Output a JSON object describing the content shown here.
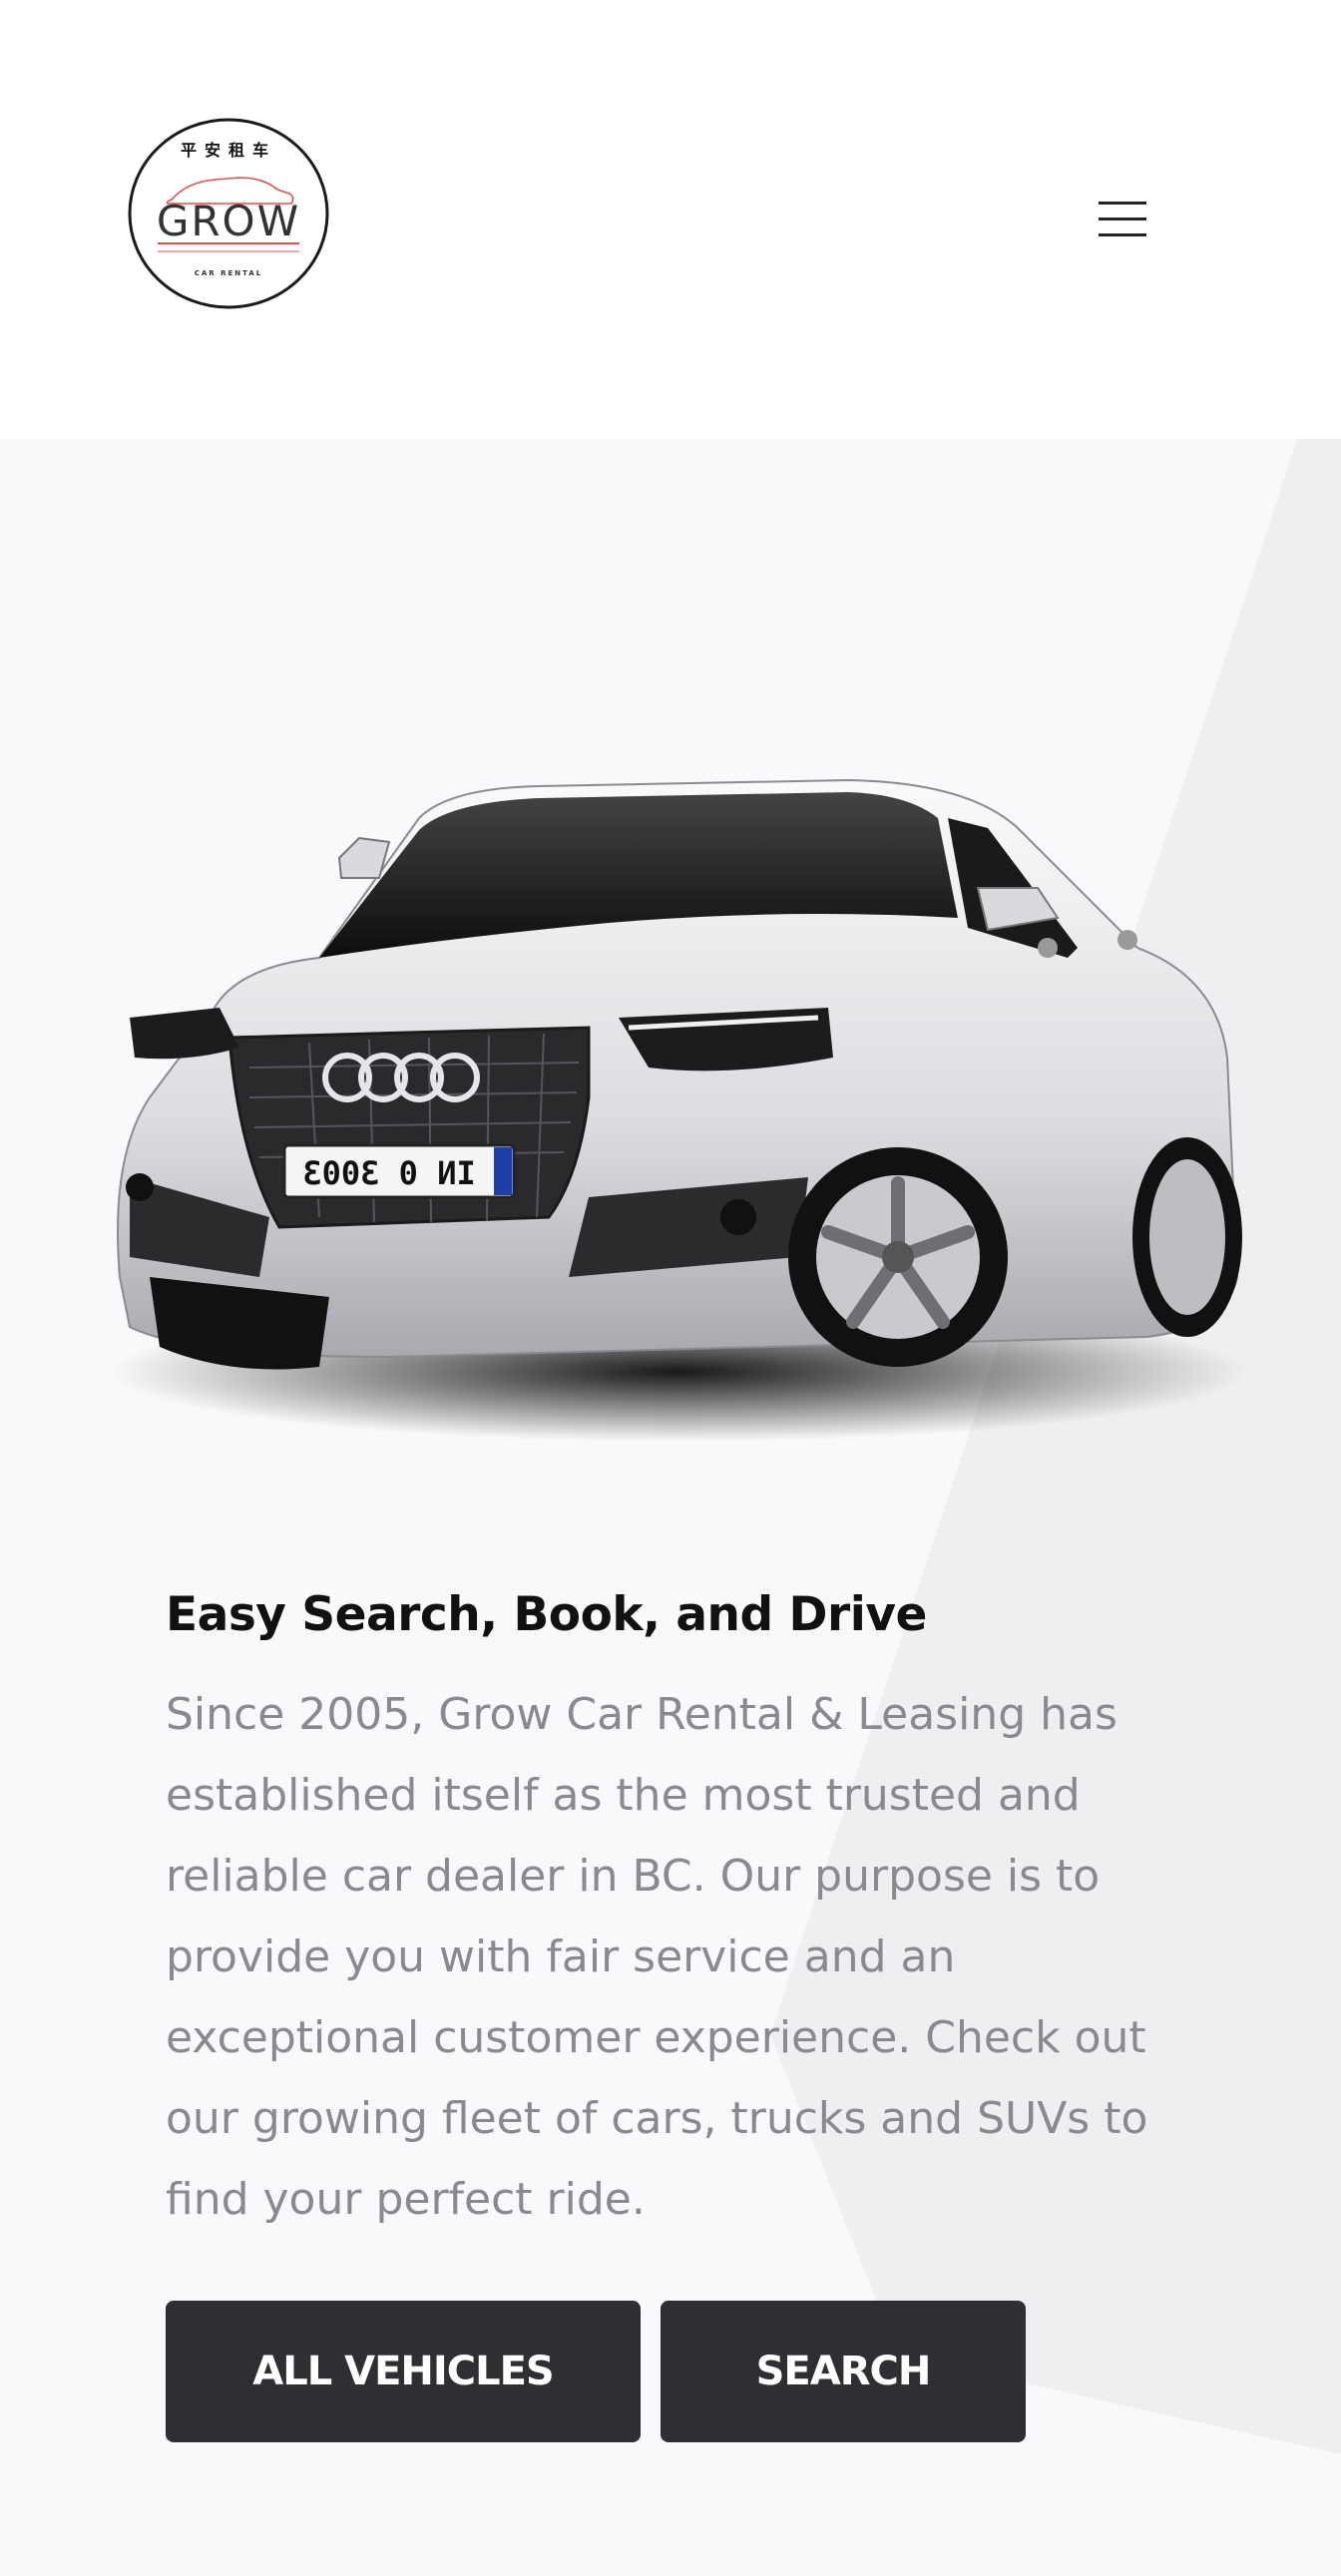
{
  "brand": {
    "logo_chinese": "平安租车",
    "logo_name": "GROW",
    "logo_tagline": "CAR RENTAL",
    "accent_color": "#d9534f"
  },
  "header": {
    "menu_icon": "hamburger-menu-icon"
  },
  "hero": {
    "plate_text": "IN 0 3003",
    "heading": "Easy Search, Book, and Drive",
    "description": "Since 2005, Grow Car Rental & Leasing has established itself as the most trusted and reliable car dealer in BC. Our purpose is to provide you with fair service and an exceptional customer experience. Check out our growing fleet of cars, trucks and SUVs to find your perfect ride.",
    "buttons": {
      "all_vehicles": "ALL VEHICLES",
      "search": "SEARCH"
    },
    "button_color": "#2e2f33",
    "background_color": "#f8f9fb"
  }
}
